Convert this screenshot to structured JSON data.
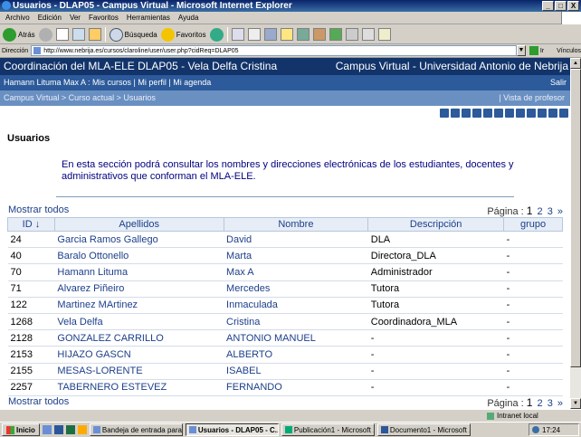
{
  "window": {
    "title": "Usuarios - DLAP05 - Campus Virtual - Microsoft Internet Explorer",
    "controls": [
      "_",
      "□",
      "X"
    ]
  },
  "menu": [
    "Archivo",
    "Edición",
    "Ver",
    "Favoritos",
    "Herramientas",
    "Ayuda"
  ],
  "toolbar": {
    "back": "Atrás",
    "search": "Búsqueda",
    "favorites": "Favoritos"
  },
  "address": {
    "label": "Dirección",
    "url": "http://www.nebrija.es/cursos/claroline/user/user.php?cidReq=DLAP05",
    "go": "Ir",
    "links": "Vínculos"
  },
  "banner": {
    "course": "Coordinación del MLA-ELE DLAP05 - Vela Delfa Cristina",
    "campus": "Campus Virtual - Universidad Antonio de Nebrija",
    "user_links": "Hamann Lituma Max A : Mis cursos | Mi perfil | Mi agenda",
    "logout": "Salir",
    "breadcrumb": "Campus Virtual > Curso actual > Usuarios",
    "view": "|  Vista de profesor"
  },
  "page": {
    "title": "Usuarios",
    "description": "En esta sección podrá consultar los nombres y direcciones electrónicas de los estudiantes, docentes y administrativos que conforman el MLA-ELE.",
    "show_all": "Mostrar todos",
    "pagination_label": "Página :",
    "current_page": "1",
    "pages": [
      "2",
      "3",
      "»"
    ]
  },
  "table": {
    "headers": [
      "ID ↓",
      "Apellidos",
      "Nombre",
      "Descripción",
      "grupo"
    ],
    "rows": [
      [
        "24",
        "Garcia Ramos Gallego",
        "David",
        "DLA",
        "-"
      ],
      [
        "40",
        "Baralo Ottonello",
        "Marta",
        "Directora_DLA",
        "-"
      ],
      [
        "70",
        "Hamann Lituma",
        "Max A",
        "Administrador",
        "-"
      ],
      [
        "71",
        "Alvarez Piñeiro",
        "Mercedes",
        "Tutora",
        "-"
      ],
      [
        "122",
        "Martinez MArtinez",
        "Inmaculada",
        "Tutora",
        "-"
      ],
      [
        "1268",
        "Vela Delfa",
        "Cristina",
        "Coordinadora_MLA",
        "-"
      ],
      [
        "2128",
        "GONZALEZ CARRILLO",
        "ANTONIO MANUEL",
        "-",
        "-"
      ],
      [
        "2153",
        "HIJAZO GASCN",
        "ALBERTO",
        "-",
        "-"
      ],
      [
        "2155",
        "MESAS-LORENTE",
        "ISABEL",
        "-",
        "-"
      ],
      [
        "2257",
        "TABERNERO ESTEVEZ",
        "FERNANDO",
        "-",
        "-"
      ]
    ]
  },
  "status": {
    "zone": "Intranet local"
  },
  "taskbar": {
    "start": "Inicio",
    "tasks": [
      "Bandeja de entrada para ...",
      "Usuarios - DLAP05 - C...",
      "Publicación1 - Microsoft ...",
      "Documento1 - Microsoft ..."
    ],
    "time": "17:24"
  },
  "colors": {
    "banner_dark": "#12346a",
    "banner_mid": "#2c5a9a",
    "banner_light": "#6a90c2",
    "link": "#1c3f8a",
    "description": "#000080"
  }
}
